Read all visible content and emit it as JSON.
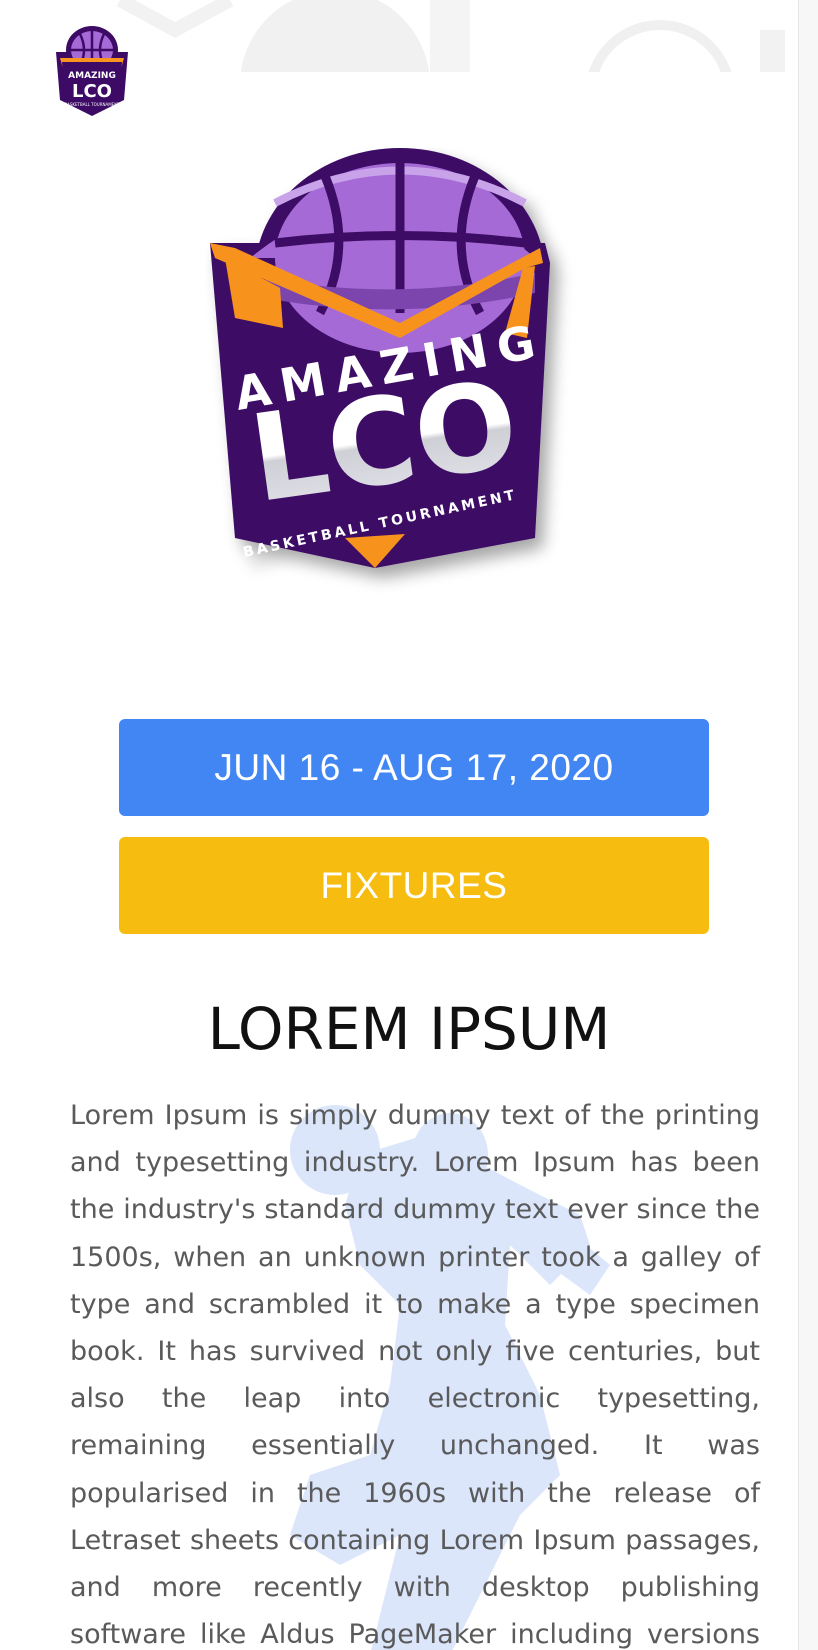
{
  "header": {
    "logo_name": "amazing-lco-logo-small"
  },
  "hero": {
    "logo": {
      "line1": "AMAZING",
      "line2": "LCO",
      "line3": "BASKETBALL TOURNAMENT"
    }
  },
  "buttons": {
    "date_label": "JUN 16 - AUG 17, 2020",
    "fixtures_label": "FIXTURES"
  },
  "section": {
    "title": "LOREM IPSUM",
    "body": "Lorem Ipsum is simply dummy text of the printing and typesetting industry. Lorem Ipsum has been the industry's standard dummy text ever since the 1500s, when an unknown printer took a galley of type and scrambled it to make a type specimen book. It has survived not only five centuries, but also the leap into electronic typesetting, remaining essentially unchanged. It was popularised in the 1960s with the release of Letraset sheets containing Lorem Ipsum passages, and more recently with desktop publishing software like Aldus PageMaker including versions of Lorem Ipsum."
  },
  "colors": {
    "date_button": "#4286f4",
    "fixtures_button": "#f6bd10",
    "logo_purple_dark": "#3d0a66",
    "logo_purple_light": "#a66ad6",
    "logo_orange": "#f7931e",
    "watermark_blue": "#dbe6fb"
  }
}
